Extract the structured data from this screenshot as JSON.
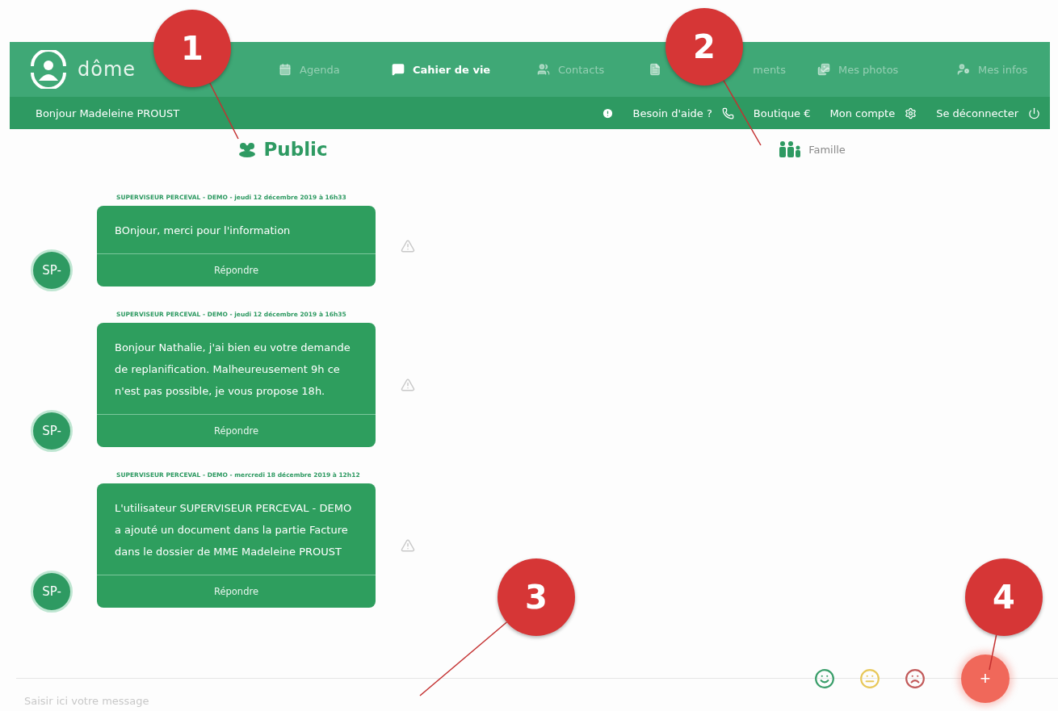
{
  "header": {
    "logo_text": "dôme",
    "nav": [
      {
        "label": "Agenda",
        "selected": false
      },
      {
        "label": "Cahier de vie",
        "selected": true
      },
      {
        "label": "Contacts",
        "selected": false
      },
      {
        "label": "ments",
        "selected": false
      },
      {
        "label": "Mes photos",
        "selected": false
      },
      {
        "label": "Mes infos",
        "selected": false
      }
    ],
    "greeting": "Bonjour Madeleine PROUST",
    "links": [
      {
        "label": "Besoin d'aide ?"
      },
      {
        "label": "Boutique €"
      },
      {
        "label": "Mon compte"
      },
      {
        "label": "Se déconnecter"
      }
    ]
  },
  "channels": [
    {
      "label": "Public",
      "selected": true
    },
    {
      "label": "Famille",
      "selected": false
    }
  ],
  "messages": [
    {
      "meta": "SUPERVISEUR PERCEVAL - DEMO - jeudi 12 décembre 2019 à 16h33",
      "body": "BOnjour, merci pour l'information",
      "reply": "Répondre",
      "avatar": "SP-"
    },
    {
      "meta": "SUPERVISEUR PERCEVAL - DEMO - jeudi 12 décembre 2019 à 16h35",
      "body": "Bonjour Nathalie, j'ai bien eu votre demande de replanification. Malheureusement 9h ce n'est pas possible, je vous propose 18h.",
      "reply": "Répondre",
      "avatar": "SP-"
    },
    {
      "meta": "SUPERVISEUR PERCEVAL - DEMO - mercredi 18 décembre 2019 à 12h12",
      "body": "L'utilisateur SUPERVISEUR PERCEVAL - DEMO a ajouté un document dans la partie Facture dans le dossier de MME Madeleine PROUST",
      "reply": "Répondre",
      "avatar": "SP-"
    }
  ],
  "composer": {
    "placeholder": "Saisir ici votre message",
    "moods": [
      {
        "kind": "happy",
        "color": "#3a9e6a"
      },
      {
        "kind": "neutral",
        "color": "#e8c85a"
      },
      {
        "kind": "sad",
        "color": "#c25a5a"
      }
    ],
    "add_button": "+"
  },
  "callouts": [
    {
      "number": "1"
    },
    {
      "number": "2"
    },
    {
      "number": "3"
    },
    {
      "number": "4"
    }
  ]
}
